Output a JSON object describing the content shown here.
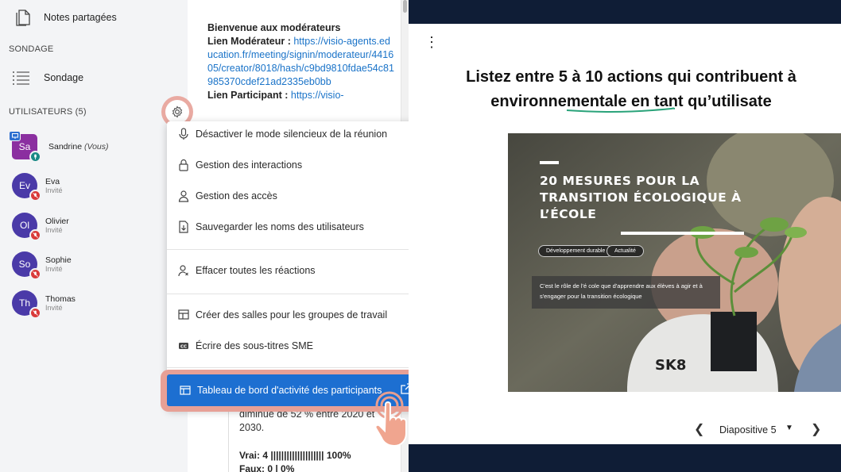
{
  "sidebar": {
    "shared_notes": "Notes partagées",
    "poll_section": "SONDAGE",
    "poll_item": "Sondage",
    "users_section": "UTILISATEURS (5)",
    "users": [
      {
        "initials": "Sa",
        "name": "Sandrine",
        "suffix": "(Vous)",
        "role": ""
      },
      {
        "initials": "Ev",
        "name": "Eva",
        "role": "Invité"
      },
      {
        "initials": "Ol",
        "name": "Olivier",
        "role": "Invité"
      },
      {
        "initials": "So",
        "name": "Sophie",
        "role": "Invité"
      },
      {
        "initials": "Th",
        "name": "Thomas",
        "role": "Invité"
      }
    ]
  },
  "chat": {
    "welcome_title": "Bienvenue aux modérateurs",
    "moderator_label": "Lien Modérateur :",
    "moderator_link": "https://visio-agents.education.fr/meeting/signin/moderateur/441605/creator/8018/hash/c9bd9810fdae54c81985370cdef21ad2335eb0bb",
    "participant_label": "Lien Participant :",
    "participant_link": "https://visio-",
    "poll_text": "diminue de 52 % entre 2020 et 2030.",
    "result_true": "Vrai: 4 |||||||||||||||||||| 100%",
    "result_false": "Faux: 0 | 0%"
  },
  "menu": {
    "items": [
      "Désactiver le mode silencieux de la réunion",
      "Gestion des interactions",
      "Gestion des accès",
      "Sauvegarder les noms des utilisateurs",
      "Effacer toutes les réactions",
      "Créer des salles pour les groupes de travail",
      "Écrire des sous-titres SME"
    ],
    "highlighted": "Tableau de bord d'activité des participants"
  },
  "presentation": {
    "title_line1_pre": "Listez entre ",
    "title_line1_hl": "5 à 10 actions",
    "title_line1_post": " qui contribuent à",
    "title_line2": "environnementale en tant qu’utilisate",
    "photo_heading": "20 MESURES POUR LA TRANSITION ÉCOLOGIQUE À L’ÉCOLE",
    "photo_tag1": "Développement durable",
    "photo_tag2": "Actualité",
    "photo_caption": "C'est le rôle de l'é cole que d'apprendre aux élèves à agir et à s'engager pour la transition écologique",
    "shirt_text": "SK8",
    "slide_label": "Diapositive 5"
  },
  "colors": {
    "accent": "#1d6fd1",
    "highlight": "#e7a096",
    "dark_bg": "#0f1d36",
    "badge_red": "#d93a3a"
  }
}
